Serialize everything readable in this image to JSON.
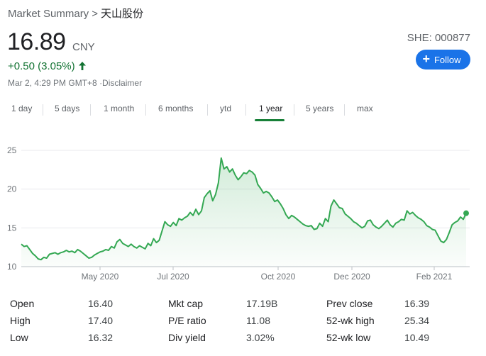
{
  "breadcrumb": {
    "parent": "Market Summary",
    "separator": ">",
    "company": "天山股份"
  },
  "quote": {
    "price": "16.89",
    "currency": "CNY",
    "change": "+0.50 (3.05%)",
    "timestamp": "Mar 2, 4:29 PM GMT+8",
    "disclaimer": "·Disclaimer",
    "ticker": "SHE: 000877"
  },
  "follow_button": {
    "label": "Follow",
    "icon": "plus-icon"
  },
  "tabs": [
    "1 day",
    "5 days",
    "1 month",
    "6 months",
    "ytd",
    "1 year",
    "5 years",
    "max"
  ],
  "active_tab": "1 year",
  "colors": {
    "line": "#34a853",
    "positive": "#137333",
    "accent": "#1a73e8"
  },
  "chart_data": {
    "type": "area",
    "ylim": [
      10,
      25.5
    ],
    "yticks": [
      "25",
      "20",
      "15",
      "10"
    ],
    "xticks": [
      "May 2020",
      "Jul 2020",
      "Oct 2020",
      "Dec 2020",
      "Feb 2021"
    ],
    "grid": true,
    "y": [
      12.9,
      12.6,
      12.7,
      12.2,
      11.7,
      11.4,
      11.0,
      10.9,
      11.2,
      11.1,
      11.6,
      11.7,
      11.8,
      11.6,
      11.8,
      11.9,
      12.1,
      11.9,
      12.0,
      11.8,
      12.2,
      12.0,
      11.7,
      11.4,
      11.1,
      11.2,
      11.5,
      11.7,
      11.9,
      12.0,
      12.2,
      12.1,
      12.6,
      12.4,
      13.2,
      13.5,
      13.0,
      12.8,
      12.6,
      12.9,
      12.6,
      12.4,
      12.7,
      12.5,
      12.3,
      13.0,
      12.7,
      13.6,
      13.1,
      13.4,
      14.6,
      15.8,
      15.4,
      15.2,
      15.7,
      15.3,
      16.2,
      16.0,
      16.3,
      16.5,
      17.0,
      16.6,
      17.4,
      16.7,
      17.2,
      18.9,
      19.4,
      19.8,
      18.5,
      19.3,
      20.8,
      24.0,
      22.6,
      22.9,
      22.2,
      22.6,
      21.8,
      21.2,
      21.6,
      22.1,
      22.0,
      22.4,
      22.2,
      21.8,
      20.6,
      20.1,
      19.5,
      19.7,
      19.5,
      19.0,
      18.4,
      18.6,
      18.1,
      17.5,
      16.7,
      16.2,
      16.6,
      16.4,
      16.1,
      15.8,
      15.5,
      15.3,
      15.2,
      15.3,
      14.8,
      14.9,
      15.6,
      15.2,
      16.2,
      15.8,
      17.8,
      18.6,
      18.1,
      17.6,
      17.5,
      16.8,
      16.5,
      16.2,
      15.8,
      15.6,
      15.3,
      15.0,
      15.2,
      15.9,
      16.0,
      15.4,
      15.1,
      14.9,
      15.2,
      15.6,
      16.0,
      15.4,
      15.1,
      15.6,
      15.8,
      16.1,
      16.0,
      17.2,
      16.8,
      17.0,
      16.6,
      16.3,
      16.1,
      15.8,
      15.3,
      15.1,
      14.8,
      14.7,
      14.0,
      13.3,
      13.1,
      13.5,
      14.4,
      15.4,
      15.7,
      15.9,
      16.4,
      16.1,
      16.89
    ],
    "last_point": 16.89
  },
  "stats": [
    {
      "label": "Open",
      "value": "16.40"
    },
    {
      "label": "High",
      "value": "17.40"
    },
    {
      "label": "Low",
      "value": "16.32"
    },
    {
      "label": "Mkt cap",
      "value": "17.19B"
    },
    {
      "label": "P/E ratio",
      "value": "11.08"
    },
    {
      "label": "Div yield",
      "value": "3.02%"
    },
    {
      "label": "Prev close",
      "value": "16.39"
    },
    {
      "label": "52-wk high",
      "value": "25.34"
    },
    {
      "label": "52-wk low",
      "value": "10.49"
    }
  ]
}
